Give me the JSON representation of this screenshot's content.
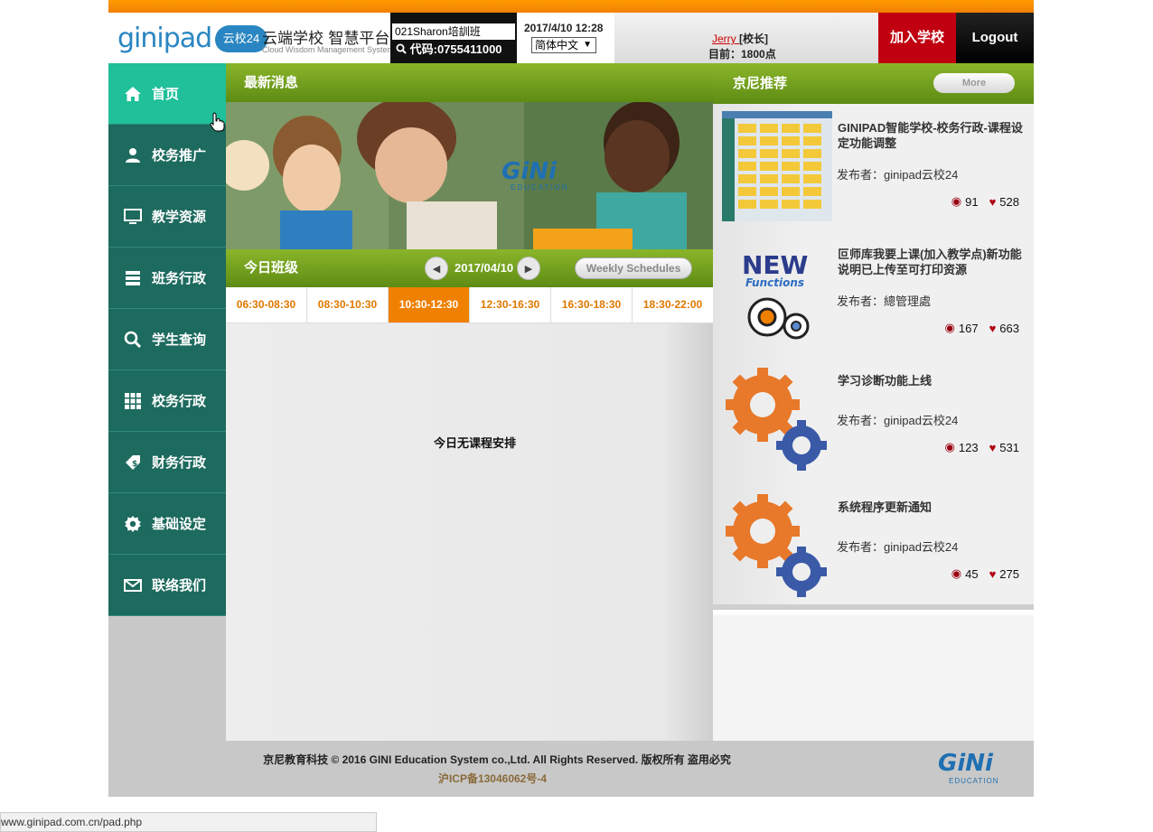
{
  "header": {
    "logo_text": "ginipad",
    "logo_badge": "云校24",
    "brand_title": "云端学校 智慧平台",
    "brand_subtitle": "Cloud Wisdom Management System",
    "class_name": "021Sharon培訓班",
    "class_code": "代码:0755411000",
    "datetime": "2017/4/10 12:28",
    "language": "简体中文",
    "user_name": "Jerry ",
    "user_role": "[校长]",
    "points": "目前：1800点",
    "join_label": "加入学校",
    "logout_label": "Logout"
  },
  "sidebar": {
    "items": [
      {
        "label": "首页"
      },
      {
        "label": "校务推广"
      },
      {
        "label": "教学资源"
      },
      {
        "label": "班务行政"
      },
      {
        "label": "学生查询"
      },
      {
        "label": "校务行政"
      },
      {
        "label": "财务行政"
      },
      {
        "label": "基础设定"
      },
      {
        "label": "联络我们"
      }
    ]
  },
  "news": {
    "title": "最新消息",
    "banner_logo": "GiNi",
    "banner_sub": "EDUCATION"
  },
  "today": {
    "title": "今日班级",
    "date": "2017/04/10",
    "weekly_label": "Weekly Schedules",
    "slots": [
      "06:30-08:30",
      "08:30-10:30",
      "10:30-12:30",
      "12:30-16:30",
      "16:30-18:30",
      "18:30-22:00"
    ],
    "active_slot": "10:30-12:30",
    "empty_text": "今日无课程安排"
  },
  "recommend": {
    "title": "京尼推荐",
    "more_label": "More",
    "items": [
      {
        "title": "GINIPAD智能学校-校务行政-课程设定功能调整",
        "publisher": "发布者：ginipad云校24",
        "views": "91",
        "likes": "528"
      },
      {
        "title": "叵师库我要上课(加入教学点)新功能说明已上传至可打印资源",
        "publisher": "发布者：總管理處",
        "views": "167",
        "likes": "663"
      },
      {
        "title": "学习诊断功能上线",
        "publisher": "发布者：ginipad云校24",
        "views": "123",
        "likes": "531"
      },
      {
        "title": "系统程序更新通知",
        "publisher": "发布者：ginipad云校24",
        "views": "45",
        "likes": "275"
      }
    ],
    "thumb_new_text": "NEW",
    "thumb_functions_text": "Functions"
  },
  "footer": {
    "copyright": "京尼教育科技 © 2016 GINI Education System co.,Ltd. All Rights Reserved. 版权所有 盗用必究",
    "icp": "沪ICP备13046062号-4",
    "logo": "GiNi",
    "logo_sub": "EDUCATION"
  },
  "statusbar": {
    "url": "www.ginipad.com.cn/pad.php"
  },
  "colors": {
    "orange": "#f08000",
    "green": "#6e9e1c",
    "teal": "#1d6a5e",
    "teal_active": "#1fc09a",
    "red": "#c00010"
  }
}
